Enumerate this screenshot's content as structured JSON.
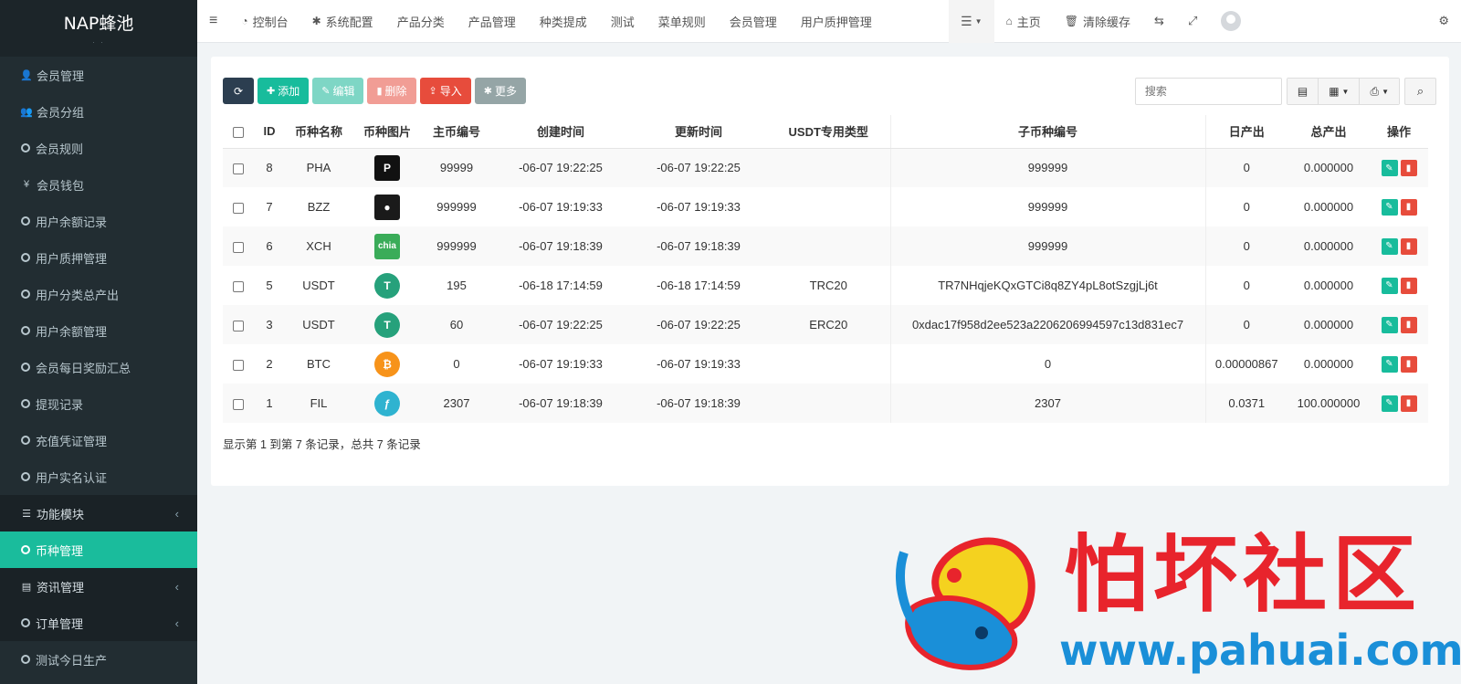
{
  "brand": {
    "title": "NAP蜂池",
    "subtitle": "· ·"
  },
  "sidebar": {
    "items": [
      {
        "label": "会员管理",
        "icon": "user-icon",
        "type": "item"
      },
      {
        "label": "会员分组",
        "icon": "users-icon",
        "type": "item"
      },
      {
        "label": "会员规则",
        "icon": "circle-icon",
        "type": "item"
      },
      {
        "label": "会员钱包",
        "icon": "yen-icon",
        "type": "item"
      },
      {
        "label": "用户余额记录",
        "icon": "circle-icon",
        "type": "item"
      },
      {
        "label": "用户质押管理",
        "icon": "circle-icon",
        "type": "item"
      },
      {
        "label": "用户分类总产出",
        "icon": "circle-icon",
        "type": "item"
      },
      {
        "label": "用户余额管理",
        "icon": "circle-icon",
        "type": "item"
      },
      {
        "label": "会员每日奖励汇总",
        "icon": "circle-icon",
        "type": "item"
      },
      {
        "label": "提现记录",
        "icon": "circle-icon",
        "type": "item"
      },
      {
        "label": "充值凭证管理",
        "icon": "circle-icon",
        "type": "item"
      },
      {
        "label": "用户实名认证",
        "icon": "circle-icon",
        "type": "item"
      },
      {
        "label": "功能模块",
        "icon": "list-icon",
        "type": "section"
      },
      {
        "label": "币种管理",
        "icon": "circle-icon",
        "type": "active"
      },
      {
        "label": "资讯管理",
        "icon": "newspaper-icon",
        "type": "section"
      },
      {
        "label": "订单管理",
        "icon": "circle-icon",
        "type": "section"
      },
      {
        "label": "测试今日生产",
        "icon": "circle-icon",
        "type": "item"
      }
    ]
  },
  "topbar": {
    "menu_toggle": "≡",
    "nav": [
      "控制台",
      "系统配置",
      "产品分类",
      "产品管理",
      "种类提成",
      "测试",
      "菜单规则",
      "会员管理",
      "用户质押管理"
    ],
    "home": "主页",
    "clear_cache": "清除缓存"
  },
  "toolbar": {
    "add": "添加",
    "edit": "编辑",
    "delete": "删除",
    "import": "导入",
    "more": "更多"
  },
  "search": {
    "placeholder": "搜索"
  },
  "table": {
    "headers": [
      "ID",
      "币种名称",
      "币种图片",
      "主币编号",
      "创建时间",
      "更新时间",
      "USDT专用类型",
      "子币种编号",
      "日产出",
      "总产出",
      "操作"
    ],
    "rows": [
      {
        "id": "8",
        "name": "PHA",
        "main": "99999",
        "created": "-06-07 19:22:25",
        "updated": "-06-07 19:22:25",
        "usdt": "",
        "sub": "999999",
        "daily": "0",
        "total": "0.000000",
        "coin_icon": "pha-coin-icon",
        "coin_color": "#111111",
        "coin_text": "P"
      },
      {
        "id": "7",
        "name": "BZZ",
        "main": "999999",
        "created": "-06-07 19:19:33",
        "updated": "-06-07 19:19:33",
        "usdt": "",
        "sub": "999999",
        "daily": "0",
        "total": "0.000000",
        "coin_icon": "bzz-coin-icon",
        "coin_color": "#1a1a1a",
        "coin_text": "●"
      },
      {
        "id": "6",
        "name": "XCH",
        "main": "999999",
        "created": "-06-07 19:18:39",
        "updated": "-06-07 19:18:39",
        "usdt": "",
        "sub": "999999",
        "daily": "0",
        "total": "0.000000",
        "coin_icon": "chia-coin-icon",
        "coin_color": "#3aac59",
        "coin_text": "chia"
      },
      {
        "id": "5",
        "name": "USDT",
        "main": "195",
        "created": "-06-18 17:14:59",
        "updated": "-06-18 17:14:59",
        "usdt": "TRC20",
        "sub": "TR7NHqjeKQxGTCi8q8ZY4pL8otSzgjLj6t",
        "daily": "0",
        "total": "0.000000",
        "coin_icon": "tether-coin-icon",
        "coin_color": "#26a17b",
        "coin_text": "T"
      },
      {
        "id": "3",
        "name": "USDT",
        "main": "60",
        "created": "-06-07 19:22:25",
        "updated": "-06-07 19:22:25",
        "usdt": "ERC20",
        "sub": "0xdac17f958d2ee523a2206206994597c13d831ec7",
        "daily": "0",
        "total": "0.000000",
        "coin_icon": "tether-coin-icon",
        "coin_color": "#26a17b",
        "coin_text": "T"
      },
      {
        "id": "2",
        "name": "BTC",
        "main": "0",
        "created": "-06-07 19:19:33",
        "updated": "-06-07 19:19:33",
        "usdt": "",
        "sub": "0",
        "daily": "0.00000867",
        "total": "0.000000",
        "coin_icon": "bitcoin-coin-icon",
        "coin_color": "#f7931a",
        "coin_text": "₿"
      },
      {
        "id": "1",
        "name": "FIL",
        "main": "2307",
        "created": "-06-07 19:18:39",
        "updated": "-06-07 19:18:39",
        "usdt": "",
        "sub": "2307",
        "daily": "0.0371",
        "total": "100.000000",
        "coin_icon": "filecoin-coin-icon",
        "coin_color": "#2fb3d0",
        "coin_text": "ƒ"
      }
    ]
  },
  "summary": "显示第 1 到第 7 条记录，总共 7 条记录",
  "watermark": {
    "text": "怕坏社区",
    "url": "www.pahuai.com"
  },
  "colors": {
    "sidebar": "#222d32",
    "active": "#1abc9c",
    "danger": "#e74c3c"
  }
}
